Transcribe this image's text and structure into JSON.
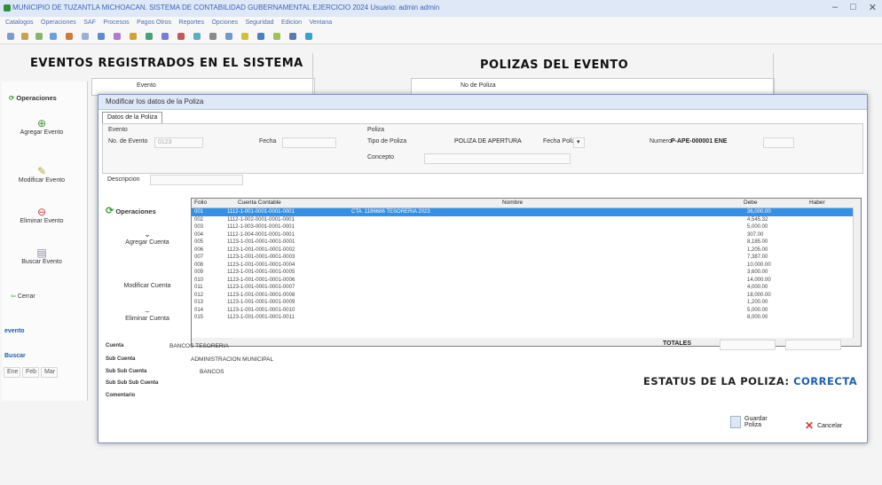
{
  "window": {
    "title": "MUNICIPIO DE TUZANTLA MICHOACAN. SISTEMA DE CONTABILIDAD GUBERNAMENTAL EJERCICIO 2024 Usuario: admin admin"
  },
  "menu": [
    "Catalogos",
    "Operaciones",
    "SAF",
    "Procesos",
    "Pagos Otros",
    "Reportes",
    "Opciones",
    "Seguridad",
    "Edicion",
    "Ventana"
  ],
  "headings": {
    "left": "EVENTOS REGISTRADOS EN EL SISTEMA",
    "right": "POLIZAS DEL EVENTO"
  },
  "bg_left": {
    "operaciones": "Operaciones",
    "agregar": "Agregar Evento",
    "modificar": "Modificar Evento",
    "eliminar": "Eliminar Evento",
    "buscar": "Buscar Evento",
    "cerrar": "Cerrar",
    "evento": "evento",
    "lbl_evento_top": "Evento",
    "no_poliza": "No de Poliza",
    "buscar2": "Buscar",
    "filter_tabs": [
      "Ene",
      "Feb",
      "Mar"
    ]
  },
  "dialog": {
    "title": "Modificar los datos de la Poliza",
    "tab": "Datos de la Poliza",
    "evento_section": "Evento",
    "no_evento_label": "No. de Evento",
    "no_evento_value": "0123",
    "fecha_label": "Fecha",
    "fecha_value": "",
    "descripcion_label": "Descripcion",
    "descripcion_value": "",
    "poliza_section": "Poliza",
    "tipo_poliza_label": "Tipo de Poliza",
    "tipo_poliza_value": "POLIZA DE APERTURA",
    "fecha_poliza_label": "Fecha Poliza",
    "numero_label": "Numero",
    "numero_value": "P-APE-000001 ENE",
    "estado_value": "",
    "concepto_label": "Concepto",
    "concepto_value": ""
  },
  "inner_sidebar": {
    "operaciones": "Operaciones",
    "agregar_cuenta": "Agregar Cuenta",
    "modificar_cuenta": "Modificar Cuenta",
    "eliminar_cuenta": "Eliminar Cuenta"
  },
  "grid": {
    "columns": [
      "Folio",
      "Cuenta Contable",
      "Nombre",
      "Debe",
      "Haber"
    ],
    "rows": [
      [
        "001",
        "1112-1-001-0001-0001-0001",
        "CTA. 1186686 TESORERIA 2023",
        "36,000.00",
        ""
      ],
      [
        "002",
        "1112-1-002-0001-0001-0001",
        "",
        "4,545.32",
        ""
      ],
      [
        "003",
        "1112-1-003-0001-0001-0001",
        "",
        "5,000.00",
        ""
      ],
      [
        "004",
        "1112-1-004-0001-0001-0001",
        "",
        "307.00",
        ""
      ],
      [
        "005",
        "1123-1-001-0001-0001-0001",
        "",
        "8,185.00",
        ""
      ],
      [
        "006",
        "1123-1-001-0001-0001-0002",
        "",
        "1,205.00",
        ""
      ],
      [
        "007",
        "1123-1-001-0001-0001-0003",
        "",
        "7,387.00",
        ""
      ],
      [
        "008",
        "1123-1-001-0001-0001-0004",
        "",
        "10,000.00",
        ""
      ],
      [
        "009",
        "1123-1-001-0001-0001-0005",
        "",
        "3,600.00",
        ""
      ],
      [
        "010",
        "1123-1-001-0001-0001-0006",
        "",
        "14,000.00",
        ""
      ],
      [
        "011",
        "1123-1-001-0001-0001-0007",
        "",
        "4,000.00",
        ""
      ],
      [
        "012",
        "1123-1-001-0001-0001-0008",
        "",
        "18,000.00",
        ""
      ],
      [
        "013",
        "1123-1-001-0001-0001-0009",
        "",
        "1,200.00",
        ""
      ],
      [
        "014",
        "1123-1-001-0001-0001-0010",
        "",
        "5,000.00",
        ""
      ],
      [
        "015",
        "1123-1-001-0001-0001-0011",
        "",
        "8,000.00",
        ""
      ]
    ]
  },
  "footer": {
    "cuenta_label": "Cuenta",
    "cuenta_value": "BANCOS TESORERIA",
    "subcuenta_label": "Sub Cuenta",
    "subcuenta_value": "ADMINISTRACION MUNICIPAL",
    "subsub_label": "Sub Sub Cuenta",
    "subsub_value": "BANCOS",
    "subsubsub_label": "Sub Sub Sub Cuenta",
    "subsubsub_value": "",
    "comentario_label": "Comentario",
    "totales_label": "TOTALES",
    "total_debe": "",
    "total_haber": ""
  },
  "status": {
    "label": "ESTATUS DE LA POLIZA:",
    "value": "CORRECTA",
    "value_color": "#1a5fb4"
  },
  "buttons": {
    "guardar": "Guardar Poliza",
    "cancelar": "Cancelar"
  }
}
